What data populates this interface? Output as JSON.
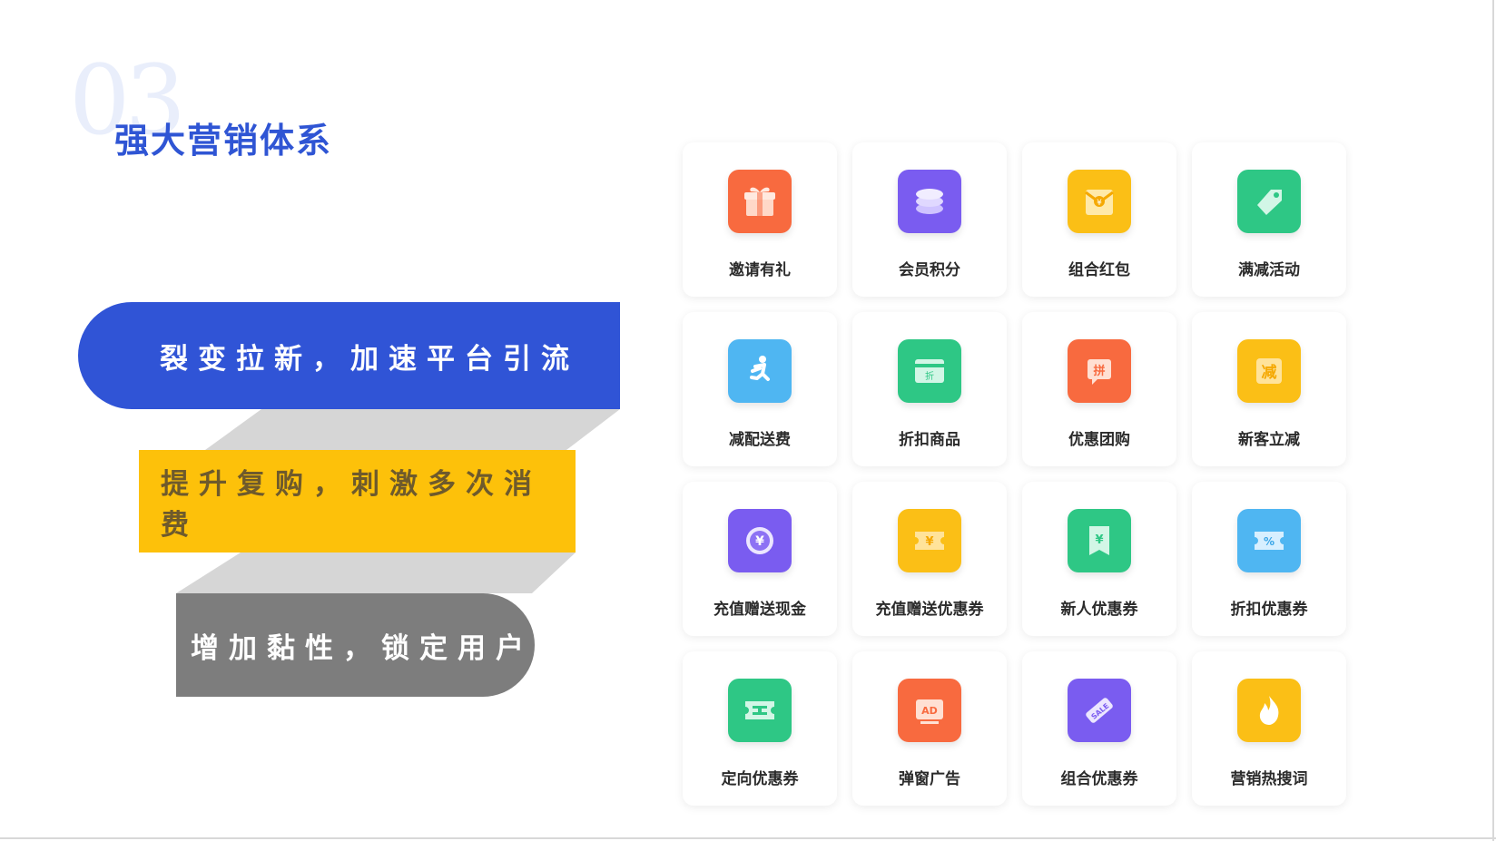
{
  "section": {
    "number": "03",
    "title": "强大营销体系"
  },
  "banners": [
    {
      "text": "裂变拉新，加速平台引流",
      "color": "#3054d6"
    },
    {
      "text": "提升复购，刺激多次消费",
      "color": "#fdc10a"
    },
    {
      "text": "增加黏性，锁定用户",
      "color": "#7d7d7d"
    }
  ],
  "features": [
    {
      "label": "邀请有礼",
      "icon": "gift-icon",
      "color": "#f86a3f"
    },
    {
      "label": "会员积分",
      "icon": "coin-stack-icon",
      "color": "#7a5cf0"
    },
    {
      "label": "组合红包",
      "icon": "red-envelope-icon",
      "color": "#fbbf16"
    },
    {
      "label": "满减活动",
      "icon": "tag-icon",
      "color": "#2ec785"
    },
    {
      "label": "减配送费",
      "icon": "runner-icon",
      "color": "#4fb6f2"
    },
    {
      "label": "折扣商品",
      "icon": "discount-card-icon",
      "color": "#2ec785"
    },
    {
      "label": "优惠团购",
      "icon": "group-buy-icon",
      "color": "#f86a3f"
    },
    {
      "label": "新客立减",
      "icon": "reduce-icon",
      "color": "#fbbf16"
    },
    {
      "label": "充值赠送现金",
      "icon": "yen-coin-icon",
      "color": "#7a5cf0"
    },
    {
      "label": "充值赠送优惠券",
      "icon": "yen-coupon-icon",
      "color": "#fbbf16"
    },
    {
      "label": "新人优惠券",
      "icon": "yen-ticket-icon",
      "color": "#2ec785"
    },
    {
      "label": "折扣优惠券",
      "icon": "percent-coupon-icon",
      "color": "#4fb6f2"
    },
    {
      "label": "定向优惠券",
      "icon": "ticket-icon",
      "color": "#2ec785"
    },
    {
      "label": "弹窗广告",
      "icon": "ad-icon",
      "color": "#f86a3f"
    },
    {
      "label": "组合优惠券",
      "icon": "sale-tag-icon",
      "color": "#7a5cf0"
    },
    {
      "label": "营销热搜词",
      "icon": "fire-icon",
      "color": "#fbbf16"
    }
  ],
  "icon_glyphs": {
    "group_buy": "拼",
    "reduce": "减",
    "discount": "折",
    "ad": "AD",
    "sale": "SALE",
    "yen": "¥",
    "percent": "%"
  }
}
